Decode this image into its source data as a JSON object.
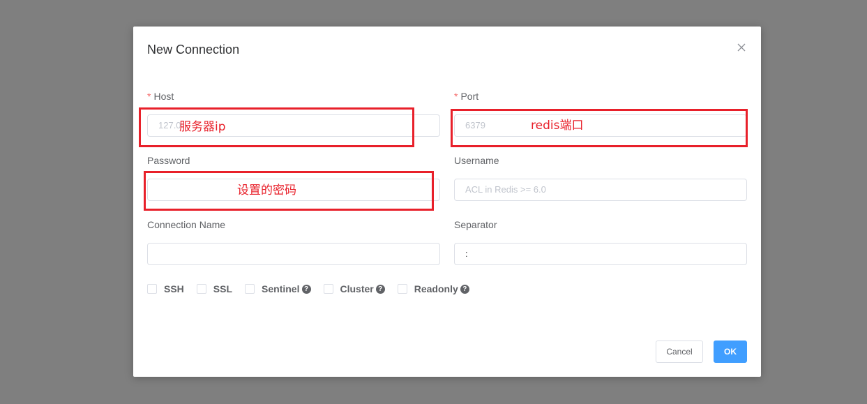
{
  "dialog": {
    "title": "New Connection",
    "close_icon": "close-icon"
  },
  "fields": {
    "host": {
      "required_mark": "*",
      "label": "Host",
      "placeholder": "127.0",
      "annotation": "服务器ip"
    },
    "port": {
      "required_mark": "*",
      "label": "Port",
      "placeholder": "6379",
      "annotation": "redis端口"
    },
    "password": {
      "label": "Password",
      "value": "",
      "annotation": "设置的密码"
    },
    "username": {
      "label": "Username",
      "placeholder": "ACL in Redis >= 6.0"
    },
    "connection_name": {
      "label": "Connection Name",
      "value": ""
    },
    "separator": {
      "label": "Separator",
      "value": ":"
    }
  },
  "options": [
    {
      "label": "SSH",
      "checked": false,
      "help": false
    },
    {
      "label": "SSL",
      "checked": false,
      "help": false
    },
    {
      "label": "Sentinel",
      "checked": false,
      "help": true
    },
    {
      "label": "Cluster",
      "checked": false,
      "help": true
    },
    {
      "label": "Readonly",
      "checked": false,
      "help": true
    }
  ],
  "help_glyph": "?",
  "buttons": {
    "cancel": "Cancel",
    "ok": "OK"
  },
  "colors": {
    "overlay": "#7f7f7f",
    "primary": "#409eff",
    "required": "#f56c6c",
    "annotation": "#e8202a"
  }
}
